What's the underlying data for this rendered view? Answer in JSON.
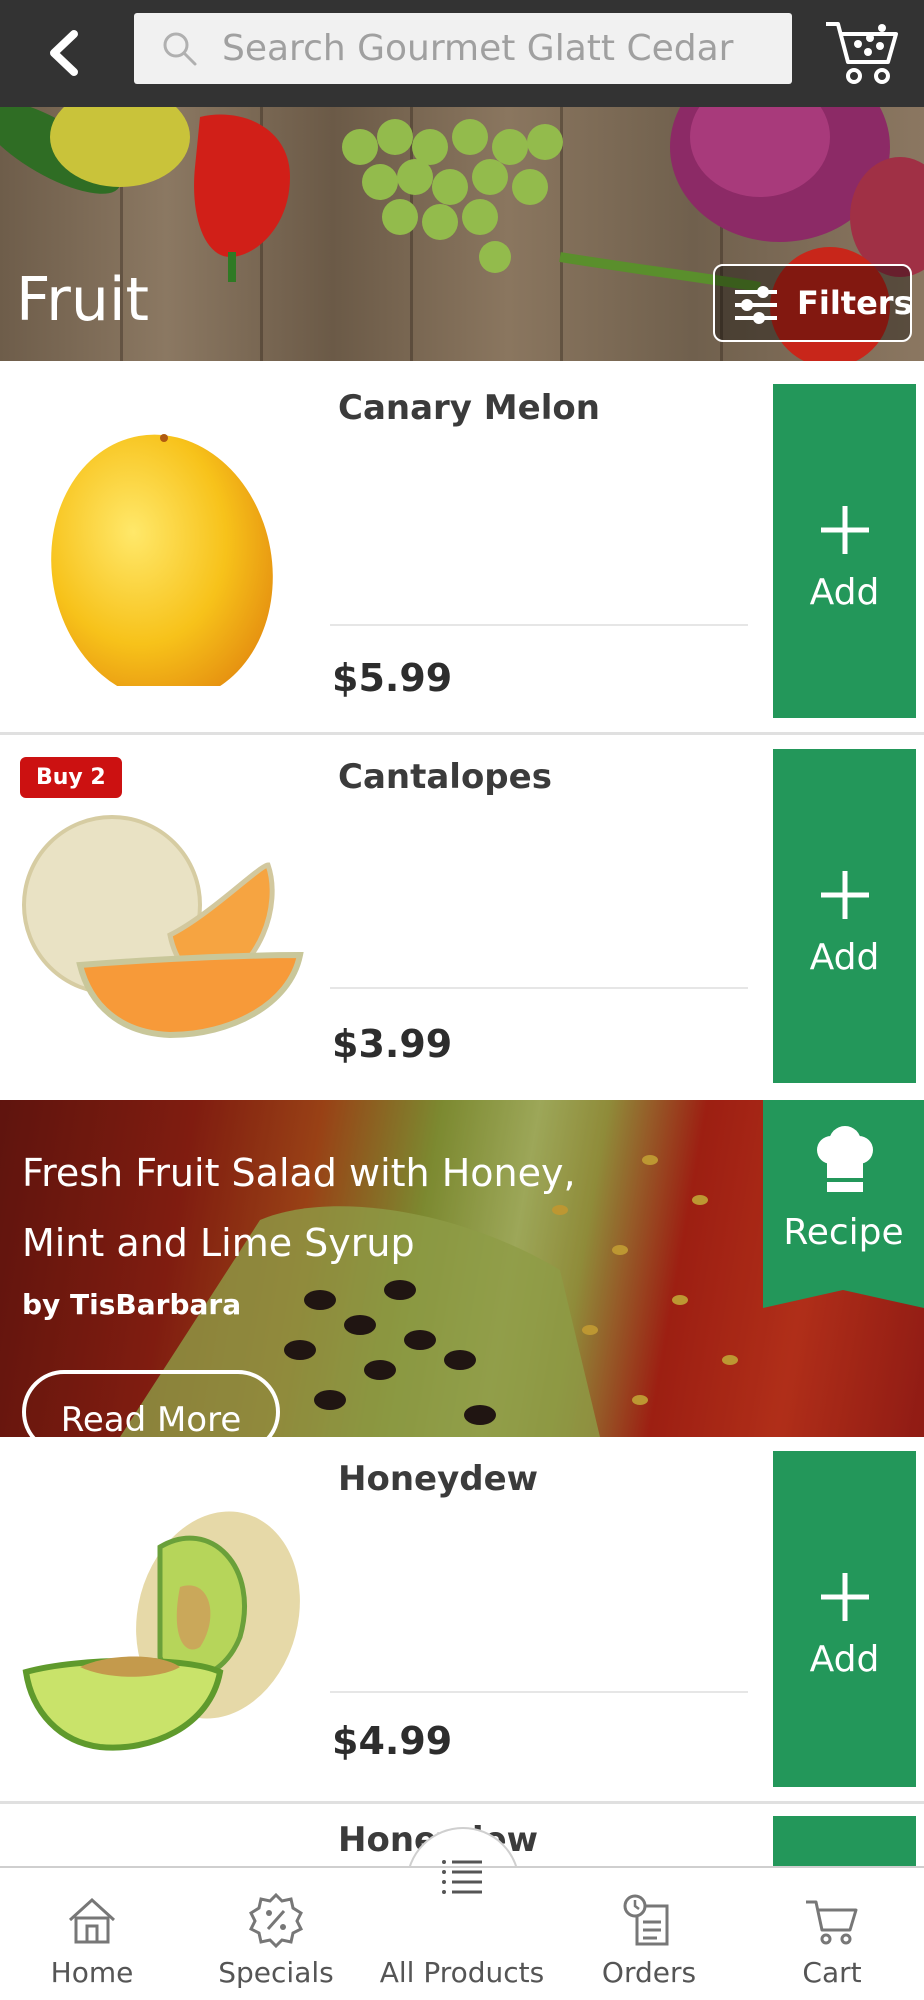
{
  "header": {
    "search_placeholder": "Search Gourmet Glatt Cedar",
    "icons": {
      "back": "chevron-left-icon",
      "search": "search-icon",
      "cart": "cart-icon"
    }
  },
  "hero": {
    "title": "Fruit",
    "filters_label": "Filters"
  },
  "products": [
    {
      "name": "Canary Melon",
      "price": "$5.99",
      "add_label": "Add",
      "badge": ""
    },
    {
      "name": "Cantalopes",
      "price": "$3.99",
      "add_label": "Add",
      "badge": "Buy 2"
    },
    {
      "name": "Honeydew",
      "price": "$4.99",
      "add_label": "Add",
      "badge": ""
    },
    {
      "name": "Honeydew",
      "price": "",
      "add_label": "",
      "badge": ""
    }
  ],
  "recipe": {
    "title": "Fresh Fruit Salad with Honey, Mint and Lime Syrup",
    "author": "by TisBarbara",
    "read_more": "Read More",
    "ribbon_label": "Recipe"
  },
  "bottom_nav": {
    "items": [
      {
        "label": "Home",
        "icon": "home-icon"
      },
      {
        "label": "Specials",
        "icon": "percent-badge-icon"
      },
      {
        "label": "All Products",
        "icon": "list-icon"
      },
      {
        "label": "Orders",
        "icon": "orders-icon"
      },
      {
        "label": "Cart",
        "icon": "cart-icon"
      }
    ]
  },
  "colors": {
    "topbar": "#333333",
    "add_button": "#23975a",
    "badge": "#cc1111"
  }
}
